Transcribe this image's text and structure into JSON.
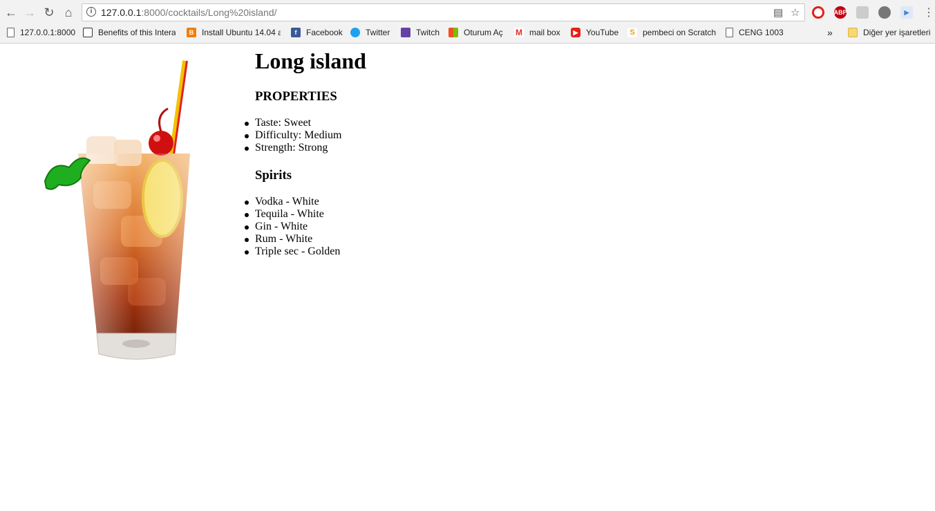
{
  "browser": {
    "url_host": "127.0.0.1",
    "url_rest": ":8000/cocktails/Long%20island/",
    "bookmarks": [
      {
        "label": "127.0.0.1:8000",
        "icon": "page-icon"
      },
      {
        "label": "Benefits of this Intera",
        "icon": "site-icon"
      },
      {
        "label": "Install Ubuntu 14.04 a",
        "icon": "blogger-icon"
      },
      {
        "label": "Facebook",
        "icon": "facebook-icon"
      },
      {
        "label": "Twitter",
        "icon": "twitter-icon"
      },
      {
        "label": "Twitch",
        "icon": "twitch-icon"
      },
      {
        "label": "Oturum Aç",
        "icon": "microsoft-icon"
      },
      {
        "label": "mail box",
        "icon": "gmail-icon"
      },
      {
        "label": "YouTube",
        "icon": "youtube-icon"
      },
      {
        "label": "pembeci on Scratch",
        "icon": "scratch-icon"
      },
      {
        "label": "CENG 1003",
        "icon": "page-icon"
      }
    ],
    "more_label": "»",
    "other_bookmarks": "Diğer yer işaretleri"
  },
  "page": {
    "title": "Long island",
    "properties_heading": "PROPERTIES",
    "properties": [
      "Taste: Sweet",
      "Difficulty: Medium",
      "Strength: Strong"
    ],
    "spirits_heading": "Spirits",
    "spirits": [
      "Vodka - White",
      "Tequila - White",
      "Gin - White",
      "Rum - White",
      "Triple sec - Golden"
    ]
  }
}
